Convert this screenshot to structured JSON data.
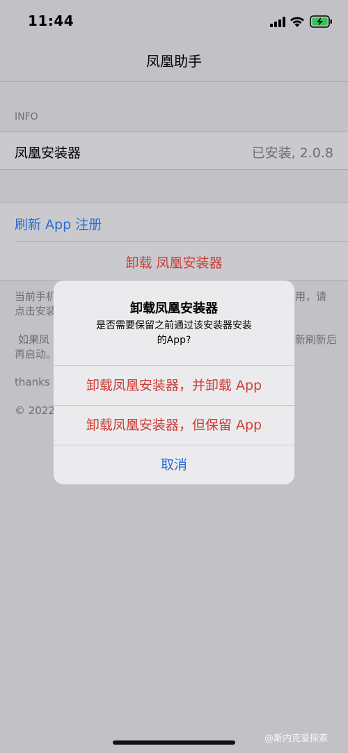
{
  "status_bar": {
    "time": "11:44"
  },
  "nav": {
    "title": "凤凰助手"
  },
  "info": {
    "header": "INFO",
    "row": {
      "label": "凤凰安装器",
      "value": "已安装, 2.0.8"
    }
  },
  "actions": {
    "refresh_label": "刷新 App 注册",
    "uninstall_label": "卸载 凤凰安装器"
  },
  "footer": {
    "line1_left": "当前手机",
    "line1_right": "用，请",
    "line2": "点击安装",
    "line3_left": "如果凤",
    "line3_right": "新刷新后",
    "line4": "再启动。",
    "thanks": "thanks",
    "copyright": "© 2022"
  },
  "alert": {
    "title": "卸载凤凰安装器",
    "message_line1": "是否需要保留之前通过该安装器安装",
    "message_line2": "的App?",
    "button_uninstall_all": "卸载凤凰安装器，并卸载 App",
    "button_uninstall_keep": "卸载凤凰安装器，但保留 App",
    "button_cancel": "取消"
  },
  "watermark": "@斯内克爱探索",
  "colors": {
    "link": "#2a6dd2",
    "destructive": "#cc3c35",
    "background": "#c2c2c6",
    "alert_bg": "#ebebed"
  }
}
